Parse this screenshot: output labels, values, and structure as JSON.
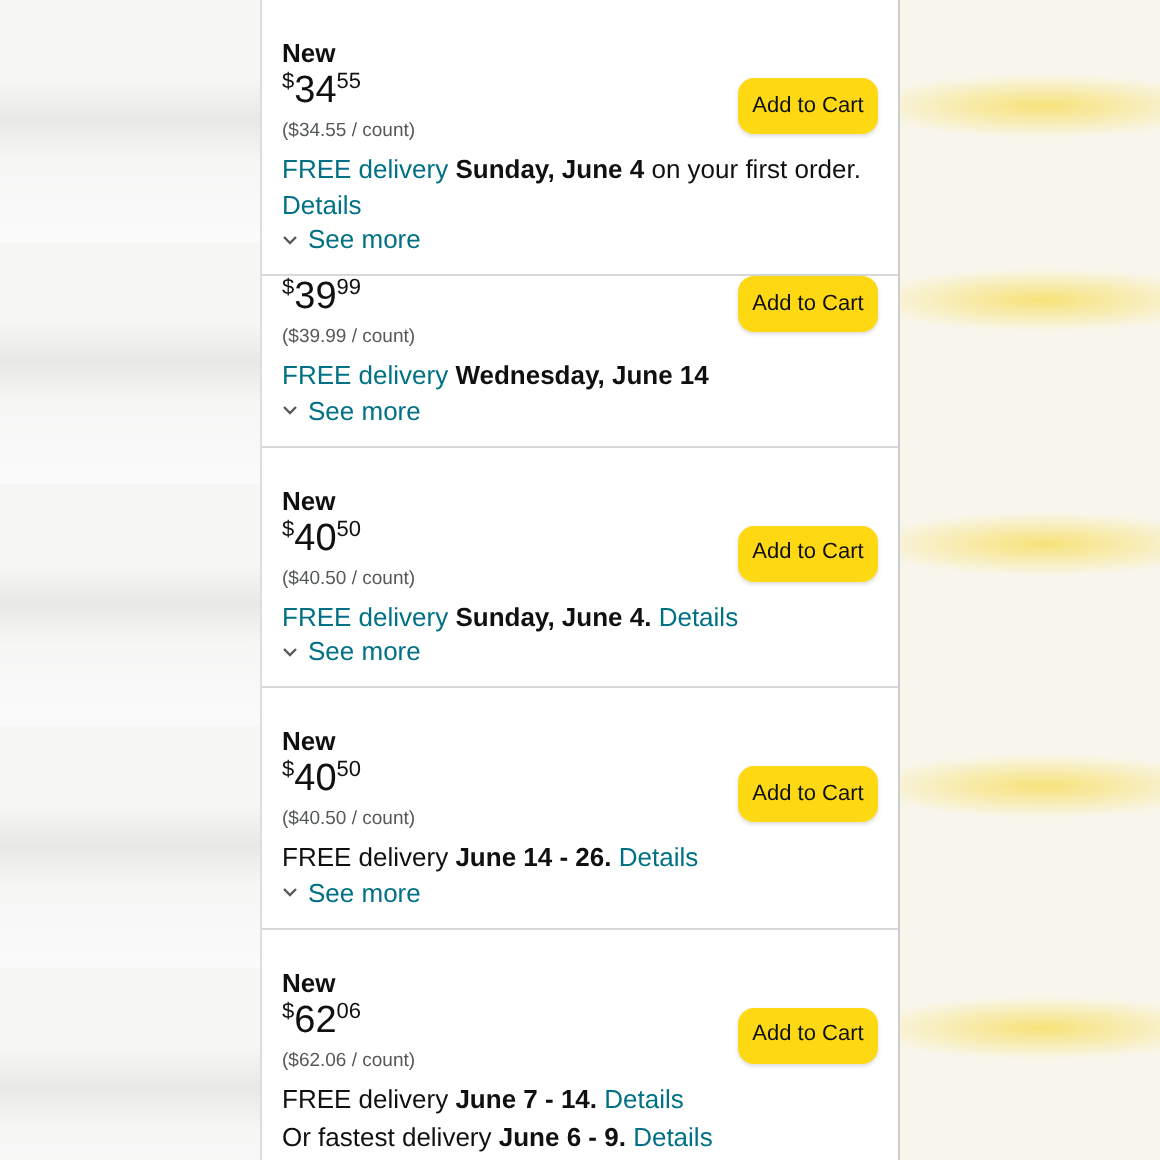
{
  "offers": [
    {
      "condition": "New",
      "cut_off": false,
      "price": {
        "symbol": "$",
        "whole": "34",
        "fraction": "55"
      },
      "unit_price": "($34.55 / count)",
      "button": "Add to Cart",
      "delivery": [
        [
          {
            "kind": "link",
            "text": "FREE delivery "
          },
          {
            "kind": "bold",
            "text": "Sunday, June 4"
          },
          {
            "kind": "plain",
            "text": " on your first order. "
          },
          {
            "kind": "link",
            "text": "Details"
          }
        ]
      ],
      "see_more": "See more"
    },
    {
      "cut_off": true,
      "price": {
        "symbol": "$",
        "whole": "39",
        "fraction": "99"
      },
      "unit_price": "($39.99 / count)",
      "button": "Add to Cart",
      "delivery": [
        [
          {
            "kind": "link",
            "text": "FREE delivery "
          },
          {
            "kind": "bold",
            "text": "Wednesday, June 14"
          }
        ]
      ],
      "see_more": "See more"
    },
    {
      "condition": "New",
      "cut_off": false,
      "price": {
        "symbol": "$",
        "whole": "40",
        "fraction": "50"
      },
      "unit_price": "($40.50 / count)",
      "button": "Add to Cart",
      "delivery": [
        [
          {
            "kind": "link",
            "text": "FREE delivery "
          },
          {
            "kind": "bold",
            "text": "Sunday, June 4. "
          },
          {
            "kind": "link",
            "text": "Details"
          }
        ]
      ],
      "see_more": "See more"
    },
    {
      "condition": "New",
      "cut_off": false,
      "price": {
        "symbol": "$",
        "whole": "40",
        "fraction": "50"
      },
      "unit_price": "($40.50 / count)",
      "button": "Add to Cart",
      "delivery": [
        [
          {
            "kind": "plain",
            "text": "FREE delivery "
          },
          {
            "kind": "bold",
            "text": "June 14 - 26. "
          },
          {
            "kind": "link",
            "text": "Details"
          }
        ]
      ],
      "see_more": "See more"
    },
    {
      "condition": "New",
      "cut_off": false,
      "price": {
        "symbol": "$",
        "whole": "62",
        "fraction": "06"
      },
      "unit_price": "($62.06 / count)",
      "button": "Add to Cart",
      "delivery": [
        [
          {
            "kind": "plain",
            "text": "FREE delivery "
          },
          {
            "kind": "bold",
            "text": "June 7 - 14. "
          },
          {
            "kind": "link",
            "text": "Details"
          }
        ],
        [
          {
            "kind": "plain",
            "text": "Or fastest delivery "
          },
          {
            "kind": "bold",
            "text": "June 6 - 9. "
          },
          {
            "kind": "link",
            "text": "Details"
          }
        ]
      ]
    }
  ]
}
